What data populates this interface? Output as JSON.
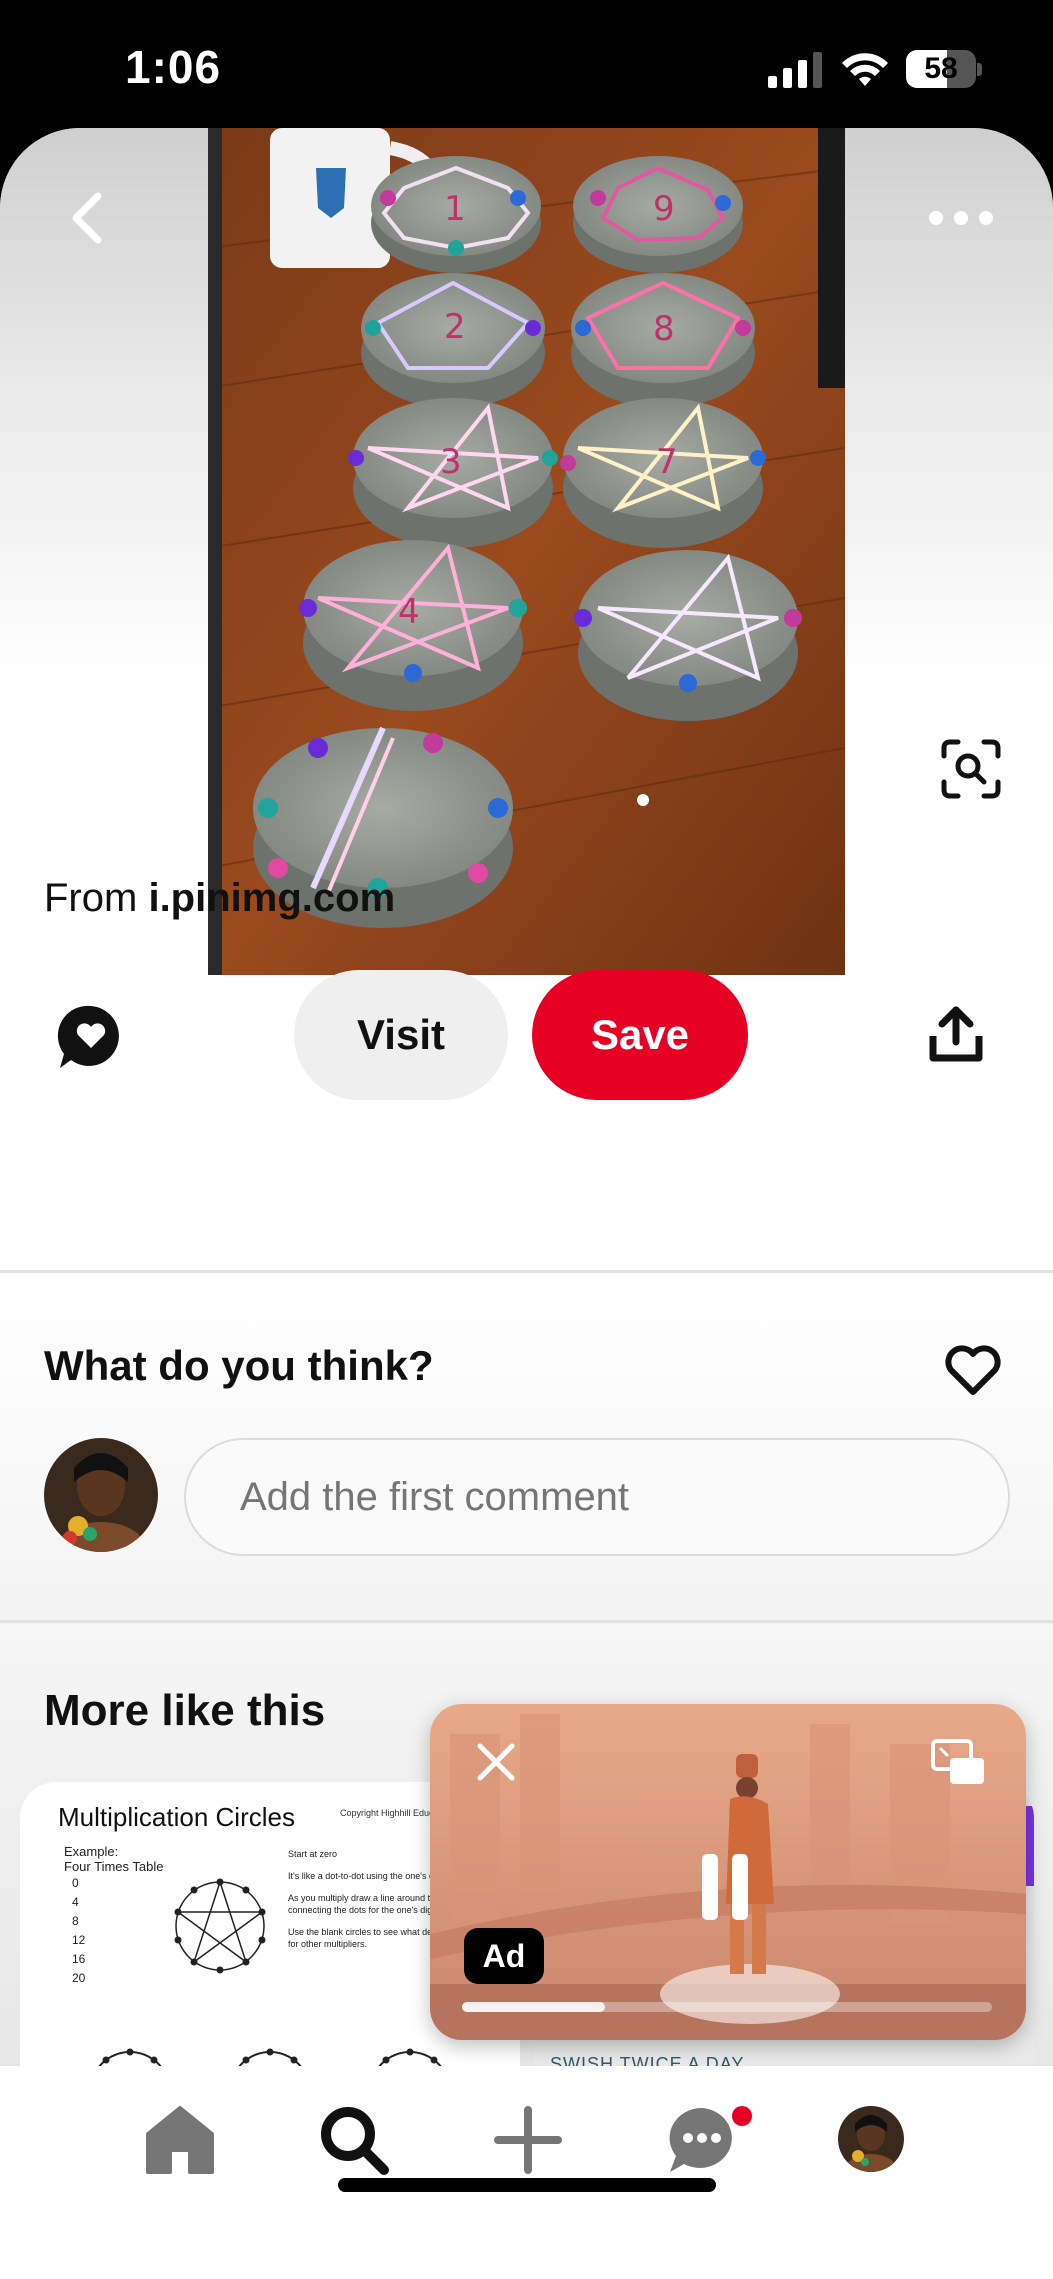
{
  "status_bar": {
    "time": "1:06",
    "battery": "58",
    "battery_level": 0.58
  },
  "pin": {
    "source_prefix": "From",
    "source_domain": "i.pinimg.com",
    "visit_label": "Visit",
    "save_label": "Save"
  },
  "comments": {
    "title": "What do you think?",
    "input_placeholder": "Add the first comment"
  },
  "more_like_this": {
    "title": "More like this",
    "card1": {
      "title": "Multiplication Circles",
      "copyright": "Copyright Highhill Education",
      "example_label": "Example:",
      "table_label": "Four Times Table",
      "numbers": [
        "0",
        "4",
        "8",
        "12",
        "16",
        "20"
      ],
      "note_1": "Start at zero",
      "note_2": "It's like a dot-to-dot using the one's digit.",
      "note_3": "As you multiply draw a line around the circle connecting the dots for the one's digit.",
      "note_4": "Use the blank circles to see what designs appear for other multipliers."
    },
    "card2": {
      "text": "SWISH TWICE A DAY"
    }
  },
  "video_ad": {
    "badge": "Ad",
    "progress": 0.27
  },
  "colors": {
    "brand_red": "#e60023",
    "button_gray": "#efefef"
  },
  "tabs": [
    "home-icon",
    "search-icon",
    "plus-icon",
    "messages-icon",
    "profile-avatar"
  ]
}
